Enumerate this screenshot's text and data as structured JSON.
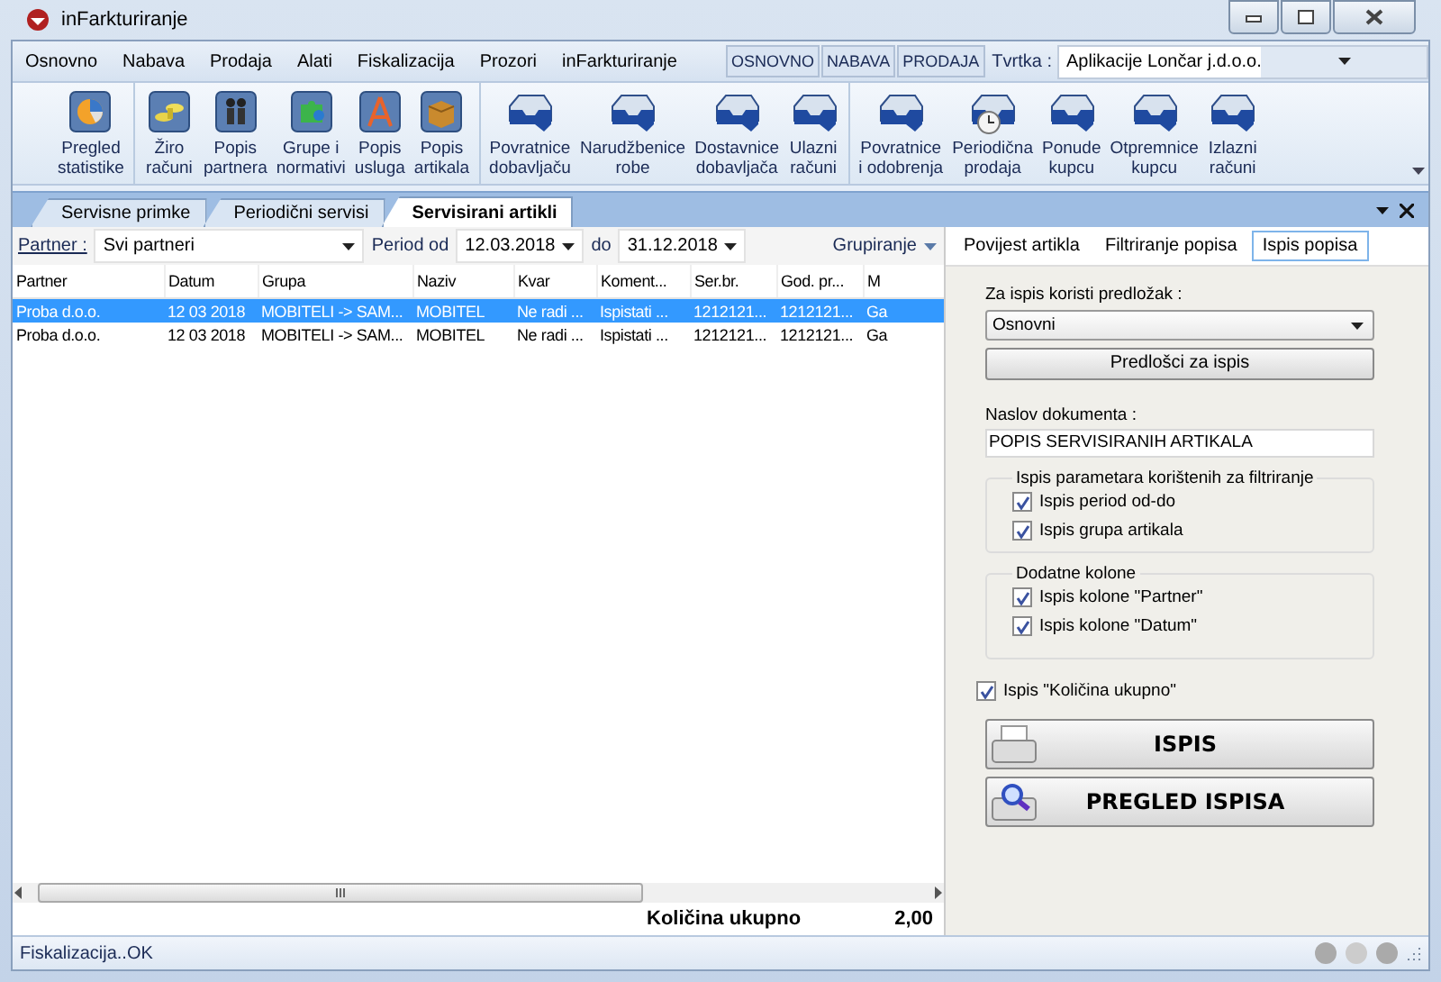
{
  "window": {
    "title": "inFarkturiranje"
  },
  "menu": [
    "Osnovno",
    "Nabava",
    "Prodaja",
    "Alati",
    "Fiskalizacija",
    "Prozori",
    "inFarkturiranje"
  ],
  "quick_buttons": [
    "OSNOVNO",
    "NABAVA",
    "PRODAJA"
  ],
  "company": {
    "label": "Tvrtka :",
    "value": "Aplikacije Lončar j.d.o.o."
  },
  "toolbar": [
    [
      {
        "label": "Pregled statistike",
        "kind": "chart"
      }
    ],
    [
      {
        "label": "Žiro računi",
        "kind": "coins"
      },
      {
        "label": "Popis partnera",
        "kind": "people"
      },
      {
        "label": "Grupe i normativi",
        "kind": "puzzle"
      },
      {
        "label": "Popis usluga",
        "kind": "compass"
      },
      {
        "label": "Popis artikala",
        "kind": "box"
      }
    ],
    [
      {
        "label": "Povratnice dobavljaču",
        "kind": "tray"
      },
      {
        "label": "Narudžbenice robe",
        "kind": "tray"
      },
      {
        "label": "Dostavnice dobavljača",
        "kind": "tray"
      },
      {
        "label": "Ulazni računi",
        "kind": "tray"
      }
    ],
    [
      {
        "label": "Povratnice i odobrenja",
        "kind": "tray"
      },
      {
        "label": "Periodična prodaja",
        "kind": "tray-clock"
      },
      {
        "label": "Ponude kupcu",
        "kind": "tray"
      },
      {
        "label": "Otpremnice kupcu",
        "kind": "tray"
      },
      {
        "label": "Izlazni računi",
        "kind": "tray"
      }
    ]
  ],
  "document_tabs": [
    {
      "label": "Servisne primke",
      "selected": false
    },
    {
      "label": "Periodični servisi",
      "selected": false
    },
    {
      "label": "Servisirani artikli",
      "selected": true
    }
  ],
  "filter": {
    "partner_label": "Partner :",
    "partner": "Svi partneri",
    "period_label": "Period od",
    "date_from": "12.03.2018",
    "to_label": "do",
    "date_to": "31.12.2018",
    "grouping": "Grupiranje"
  },
  "table": {
    "columns": [
      "Partner",
      "Datum",
      "Grupa",
      "Naziv",
      "Kvar",
      "Koment...",
      "Ser.br.",
      "God. pr...",
      "M"
    ],
    "rows": [
      {
        "selected": true,
        "cells": [
          "Proba d.o.o.",
          "12 03 2018",
          "MOBITELI -> SAM...",
          "MOBITEL",
          "Ne radi ...",
          "Ispistati ...",
          "1212121...",
          "1212121...",
          "Ga"
        ]
      },
      {
        "selected": false,
        "cells": [
          "Proba d.o.o.",
          "12 03 2018",
          "MOBITELI -> SAM...",
          "MOBITEL",
          "Ne radi ...",
          "Ispistati ...",
          "1212121...",
          "1212121...",
          "Ga"
        ]
      }
    ]
  },
  "total": {
    "label": "Količina ukupno",
    "value": "2,00"
  },
  "side_tabs": [
    {
      "label": "Povijest artikla",
      "selected": false
    },
    {
      "label": "Filtriranje popisa",
      "selected": false
    },
    {
      "label": "Ispis popisa",
      "selected": true
    }
  ],
  "print": {
    "template_label": "Za ispis koristi predložak :",
    "template": "Osnovni",
    "templates_button": "Predlošci za ispis",
    "title_label": "Naslov dokumenta :",
    "title": "POPIS SERVISIRANIH ARTIKALA",
    "groups": [
      {
        "title": "Ispis parametara korištenih za filtriranje",
        "options": [
          {
            "label": "Ispis period od-do",
            "checked": true
          },
          {
            "label": "Ispis grupa artikala",
            "checked": true
          }
        ]
      },
      {
        "title": "Dodatne kolone",
        "options": [
          {
            "label": "Ispis kolone \"Partner\"",
            "checked": true
          },
          {
            "label": "Ispis kolone \"Datum\"",
            "checked": true
          }
        ]
      }
    ],
    "total_option": {
      "label": "Ispis \"Količina ukupno\"",
      "checked": true
    },
    "buttons": [
      {
        "label": "ISPIS",
        "kind": "print"
      },
      {
        "label": "PREGLED ISPISA",
        "kind": "preview"
      }
    ]
  },
  "status_bar": "Fiskalizacija..OK"
}
